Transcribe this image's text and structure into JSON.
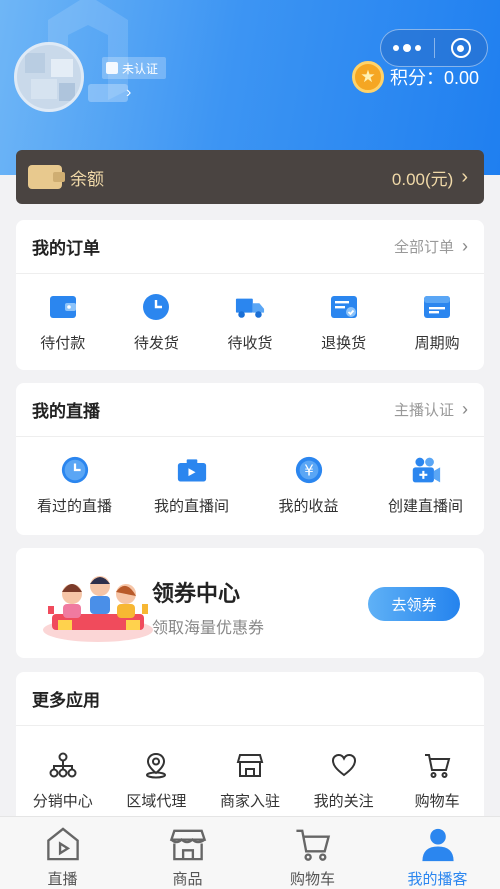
{
  "header": {
    "verify_label": "未认证",
    "points_label": "积分：",
    "points_value": "0.00"
  },
  "balance": {
    "label": "余额",
    "amount": "0.00(元)"
  },
  "orders": {
    "title": "我的订单",
    "link": "全部订单",
    "items": [
      {
        "label": "待付款",
        "icon": "wallet-icon"
      },
      {
        "label": "待发货",
        "icon": "clock-icon"
      },
      {
        "label": "待收货",
        "icon": "truck-icon"
      },
      {
        "label": "退换货",
        "icon": "return-icon"
      },
      {
        "label": "周期购",
        "icon": "calendar-icon"
      }
    ]
  },
  "live": {
    "title": "我的直播",
    "link": "主播认证",
    "items": [
      {
        "label": "看过的直播",
        "icon": "clock-icon"
      },
      {
        "label": "我的直播间",
        "icon": "camera-icon"
      },
      {
        "label": "我的收益",
        "icon": "yen-icon"
      },
      {
        "label": "创建直播间",
        "icon": "video-add-icon"
      }
    ]
  },
  "coupon": {
    "title": "领券中心",
    "subtitle": "领取海量优惠券",
    "button": "去领券"
  },
  "more": {
    "title": "更多应用",
    "items": [
      {
        "label": "分销中心",
        "icon": "network-icon"
      },
      {
        "label": "区域代理",
        "icon": "location-icon"
      },
      {
        "label": "商家入驻",
        "icon": "store-icon"
      },
      {
        "label": "我的关注",
        "icon": "heart-icon"
      },
      {
        "label": "购物车",
        "icon": "cart-icon"
      }
    ]
  },
  "tabbar": {
    "items": [
      {
        "label": "直播",
        "icon": "live-icon",
        "active": false
      },
      {
        "label": "商品",
        "icon": "shop-icon",
        "active": false
      },
      {
        "label": "购物车",
        "icon": "cart-icon",
        "active": false
      },
      {
        "label": "我的播客",
        "icon": "user-icon",
        "active": true
      }
    ]
  },
  "colors": {
    "primary": "#2b86ef",
    "balance_bg": "#4a4441",
    "gold": "#f0d9a8"
  }
}
